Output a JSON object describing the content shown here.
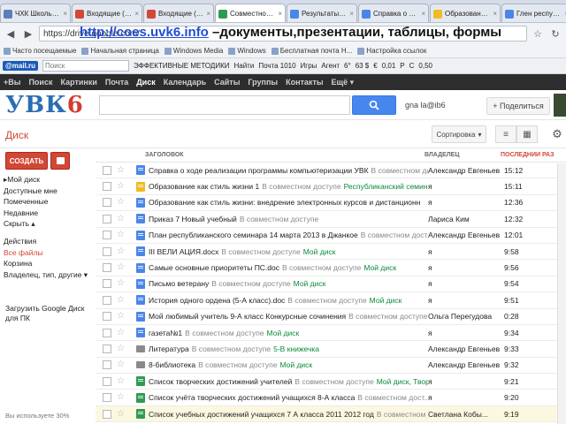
{
  "browser": {
    "tabs": [
      {
        "label": "ЧХК Школьник...",
        "color": "#5b7fb8",
        "active": false
      },
      {
        "label": "Входящие (099)",
        "color": "#d14836",
        "active": false
      },
      {
        "label": "Входящие (99)",
        "color": "#d14836",
        "active": false
      },
      {
        "label": "Совместное на...",
        "color": "#2f9b52",
        "active": true
      },
      {
        "label": "Результаты пои...",
        "color": "#4a86e8",
        "active": false
      },
      {
        "label": "Справка о ходе...",
        "color": "#4a86e8",
        "active": false
      },
      {
        "label": "Образование на...",
        "color": "#f1bb24",
        "active": false
      },
      {
        "label": "Глен респубЛик...",
        "color": "#4a86e8",
        "active": false
      }
    ],
    "address_url": "https://drive.google.com/",
    "bookmarks": [
      "Часто посещаемые",
      "Начальная страница",
      "Windows Media",
      "Windows",
      "Бесплатная почта H...",
      "Настройка ссылок"
    ],
    "ext_search_placeholder": "Поиск",
    "ext_items": [
      "ЭФФЕКТИВНЫЕ МЕТОДИКИ",
      "Найти",
      "Почта 1010",
      "Игры",
      "Агент",
      "6°",
      "63 $",
      "€",
      "0,01",
      "Р",
      "С",
      "0,50"
    ]
  },
  "overlay": {
    "link": "http://coes.uvk6.info",
    "rest": " –документы,презентации, таблицы, формы"
  },
  "gbar": [
    "+Вы",
    "Поиск",
    "Картинки",
    "Почта",
    "Диск",
    "Календарь",
    "Сайты",
    "Группы",
    "Контакты",
    "Ещё ▾"
  ],
  "header": {
    "logo_part1": "УВК",
    "logo_part2": "6",
    "user": "gna la@ib6",
    "share_label": "+ Поделиться"
  },
  "toolbar": {
    "title": "Диск",
    "sort_label": "Сортировка",
    "list_view": "≡",
    "grid_view": "▦",
    "settings": "⚙"
  },
  "sidebar": {
    "create_label": "СОЗДАТЬ",
    "items": [
      {
        "label": "▸Мой диск",
        "hl": false,
        "gap": false
      },
      {
        "label": "Доступные мне",
        "hl": false,
        "gap": false
      },
      {
        "label": "Помеченные",
        "hl": false,
        "gap": false
      },
      {
        "label": "Недавние",
        "hl": false,
        "gap": false
      },
      {
        "label": "Скрыть ▴",
        "hl": false,
        "gap": false
      },
      {
        "label": "Действия",
        "hl": false,
        "gap": true
      },
      {
        "label": "Все файлы",
        "hl": true,
        "gap": false
      },
      {
        "label": "Корзина",
        "hl": false,
        "gap": false
      },
      {
        "label": "Владелец, тип, другие ▾",
        "hl": false,
        "gap": false
      }
    ],
    "promo": "Загрузить Google Диск для ПК",
    "quota": "Вы используете 30%"
  },
  "table": {
    "headers": [
      "ЗАГОЛОВОК",
      "ВЛАДЕЛЕЦ",
      "ПОСЛЕДНИЙ РАЗ ОТ..."
    ],
    "header_accent": "#d14836",
    "rows": [
      {
        "type": "doc",
        "title": "Справка о ходе реализации программы компьютеризации УВК",
        "share": "В совместном дост...",
        "folder": "",
        "owner": "Александр Евгеньев",
        "modified": "15:12"
      },
      {
        "type": "pres",
        "title": "Образование как стиль жизни 1",
        "share": "В совместном доступе",
        "folder": "Республиканский семинар",
        "owner": "я",
        "modified": "15:11"
      },
      {
        "type": "doc",
        "title": "Образование как стиль жизни: внедрение электронных курсов и дистанционн",
        "share": "",
        "folder": "",
        "owner": "я",
        "modified": "12:36"
      },
      {
        "type": "doc",
        "title": "Приказ 7 Новый учебный",
        "share": "В совместном доступе",
        "folder": "",
        "owner": "Лариса Ким",
        "modified": "12:32"
      },
      {
        "type": "doc",
        "title": "План республиканского семинара 14 марта 2013 в Джанкое",
        "share": "В совместном доступе",
        "folder": "",
        "owner": "Александр Евгеньев",
        "modified": "12:01"
      },
      {
        "type": "doc",
        "title": "III ВЕЛИ АЦИЯ.docx",
        "share": "В совместном доступе",
        "folder": "Мой диск",
        "owner": "я",
        "modified": "9:58"
      },
      {
        "type": "doc",
        "title": "Самые основные приоритеты ПС.doc",
        "share": "В совместном доступе",
        "folder": "Мой диск",
        "owner": "я",
        "modified": "9:56"
      },
      {
        "type": "doc",
        "title": "Письмо ветерану",
        "share": "В совместном доступе",
        "folder": "Мой диск",
        "owner": "я",
        "modified": "9:54"
      },
      {
        "type": "doc",
        "title": "История одного ордена (5-А класс).doc",
        "share": "В совместном доступе",
        "folder": "Мой диск",
        "owner": "я",
        "modified": "9:51"
      },
      {
        "type": "doc",
        "title": "Мой любимый учитель 9-А класс Конкурсные сочинения",
        "share": "В совместном доступе",
        "folder": "",
        "owner": "Ольга Перегудова",
        "modified": "0:28"
      },
      {
        "type": "doc",
        "title": "газета№1",
        "share": "В совместном доступе",
        "folder": "Мой диск",
        "owner": "я",
        "modified": "9:34"
      },
      {
        "type": "folder",
        "title": "Литература",
        "share": "В совместном доступе",
        "folder": "5-В книжечка",
        "owner": "Александр Евгеньев",
        "modified": "9:33"
      },
      {
        "type": "folder",
        "title": "8-библиотека",
        "share": "В совместном доступе",
        "folder": "Мой диск",
        "owner": "Александр Евгеньев",
        "modified": "9:32"
      },
      {
        "type": "sheet",
        "title": "Список творческих достижений учителей",
        "share": "В совместном доступе",
        "folder": "Мой диск, Твор",
        "owner": "я",
        "modified": "9:21"
      },
      {
        "type": "sheet",
        "title": "Список учёта творческих достижений учащихся 8-А класса",
        "share": "В совместном дост...",
        "folder": "",
        "owner": "я",
        "modified": "9:20"
      },
      {
        "type": "sheet",
        "title": "Список учебных достижений учащихся 7 А класса 2011 2012 год",
        "share": "В совместном до...",
        "folder": "",
        "owner": "Светлана Кобы...",
        "modified": "9:19",
        "selected": true
      }
    ]
  }
}
